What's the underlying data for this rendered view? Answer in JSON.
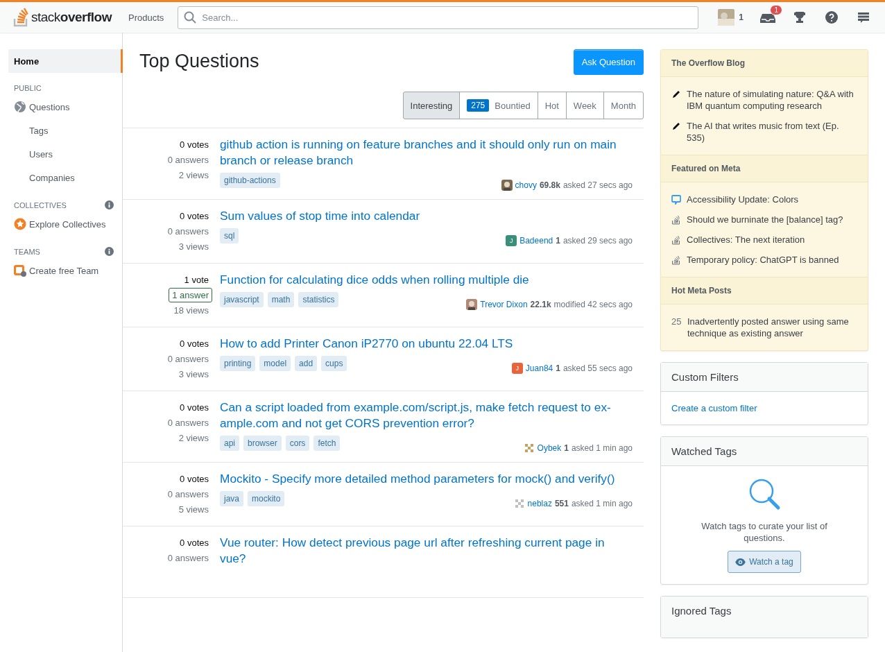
{
  "header": {
    "logo_light": "stack",
    "logo_bold": "overflow",
    "products": "Products",
    "search": {
      "placeholder": "Search..."
    },
    "reputation": "1",
    "inbox_badge": "1"
  },
  "sidebar": {
    "items": [
      {
        "label": "Home",
        "selected": true,
        "kind": "plain"
      },
      {
        "label": "PUBLIC",
        "kind": "heading"
      },
      {
        "label": "Questions",
        "selected": false,
        "kind": "globe"
      },
      {
        "label": "Tags",
        "selected": false,
        "kind": "plain"
      },
      {
        "label": "Users",
        "selected": false,
        "kind": "plain"
      },
      {
        "label": "Companies",
        "selected": false,
        "kind": "plain"
      },
      {
        "label": "COLLECTIVES",
        "kind": "heading_info"
      },
      {
        "label": "Explore Collectives",
        "selected": false,
        "kind": "collective"
      },
      {
        "label": "TEAMS",
        "kind": "heading_info"
      },
      {
        "label": "Create free Team",
        "selected": false,
        "kind": "team"
      }
    ]
  },
  "page": {
    "title": "Top Questions",
    "ask_button": "Ask Question",
    "filters": [
      {
        "label": "Interesting",
        "selected": true
      },
      {
        "label": "Bountied",
        "count": "275",
        "selected": false
      },
      {
        "label": "Hot",
        "selected": false
      },
      {
        "label": "Week",
        "selected": false
      },
      {
        "label": "Month",
        "selected": false
      }
    ]
  },
  "questions": [
    {
      "votes": "0 votes",
      "answers": "0 answers",
      "answered": false,
      "views": "2 views",
      "title": "github action is running on feature branches and it should only run on main branch or release branch",
      "tags": [
        "github-actions"
      ],
      "user": "chovy",
      "rep": "69.8k",
      "time": "asked 27 secs ago",
      "avatar": {
        "kind": "picture",
        "color": "#7a6a50"
      }
    },
    {
      "votes": "0 votes",
      "answers": "0 answers",
      "answered": false,
      "views": "3 views",
      "title": "Sum values of stop time into calendar",
      "tags": [
        "sql"
      ],
      "user": "Badeend",
      "rep": "1",
      "time": "asked 29 secs ago",
      "avatar": {
        "kind": "letter",
        "letter": "J",
        "color": "#3a8f7a"
      }
    },
    {
      "votes": "1 vote",
      "answers": "1 answer",
      "answered": true,
      "views": "18 views",
      "title": "Function for calculating dice odds when rolling multiple die",
      "tags": [
        "javascript",
        "math",
        "statistics"
      ],
      "user": "Trevor Dixon",
      "rep": "22.1k",
      "time": "modified 42 secs ago",
      "avatar": {
        "kind": "picture",
        "color": "#b08a78"
      }
    },
    {
      "votes": "0 votes",
      "answers": "0 answers",
      "answered": false,
      "views": "3 views",
      "title": "How to add Printer Canon iP2770 on ubuntu 22.04 LTS",
      "tags": [
        "printing",
        "model",
        "add",
        "cups"
      ],
      "user": "Juan84",
      "rep": "1",
      "time": "asked 55 secs ago",
      "avatar": {
        "kind": "letter",
        "letter": "J",
        "color": "#e8643c"
      }
    },
    {
      "votes": "0 votes",
      "answers": "0 answers",
      "answered": false,
      "views": "2 views",
      "title": "Can a script loaded from example.com/script.js, make fetch request to ex-ample.com and not get CORS prevention error?",
      "tags": [
        "api",
        "browser",
        "cors",
        "fetch"
      ],
      "user": "Oybek",
      "rep": "1",
      "time": "asked 1 min ago",
      "avatar": {
        "kind": "pattern",
        "color": "#c8a060"
      }
    },
    {
      "votes": "0 votes",
      "answers": "0 answers",
      "answered": false,
      "views": "5 views",
      "title": "Mockito - Specify more detailed method parameters for mock() and verify()",
      "tags": [
        "java",
        "mockito"
      ],
      "user": "neblaz",
      "rep": "551",
      "time": "asked 1 min ago",
      "avatar": {
        "kind": "pattern",
        "color": "#c0c0c0"
      }
    },
    {
      "votes": "0 votes",
      "answers": "0 answers",
      "answered": false,
      "title": "Vue router: How detect previous page url after refreshing current page in vue?"
    }
  ],
  "blog": {
    "sections": [
      {
        "title": "The Overflow Blog",
        "items": [
          {
            "kind": "pencil",
            "text": "The nature of simulating nature: Q&A with IBM quantum computing research"
          },
          {
            "kind": "pencil",
            "text": "The AI that writes music from text (Ep. 535)"
          }
        ]
      },
      {
        "title": "Featured on Meta",
        "items": [
          {
            "kind": "chat",
            "text": "Accessibility Update: Colors"
          },
          {
            "kind": "stack",
            "text": "Should we burninate the [balance] tag?"
          },
          {
            "kind": "stack",
            "text": "Collectives: The next iteration"
          },
          {
            "kind": "stack",
            "text": "Temporary policy: ChatGPT is banned"
          }
        ]
      },
      {
        "title": "Hot Meta Posts",
        "items": [
          {
            "kind": "count",
            "count": "25",
            "text": "Inadvertently posted answer using same technique as existing answer"
          }
        ]
      }
    ]
  },
  "custom_filters": {
    "title": "Custom Filters",
    "link": "Create a custom filter"
  },
  "watched_tags": {
    "title": "Watched Tags",
    "text": "Watch tags to curate your list of questions.",
    "button": "Watch a tag"
  },
  "ignored_tags": {
    "title": "Ignored Tags"
  }
}
